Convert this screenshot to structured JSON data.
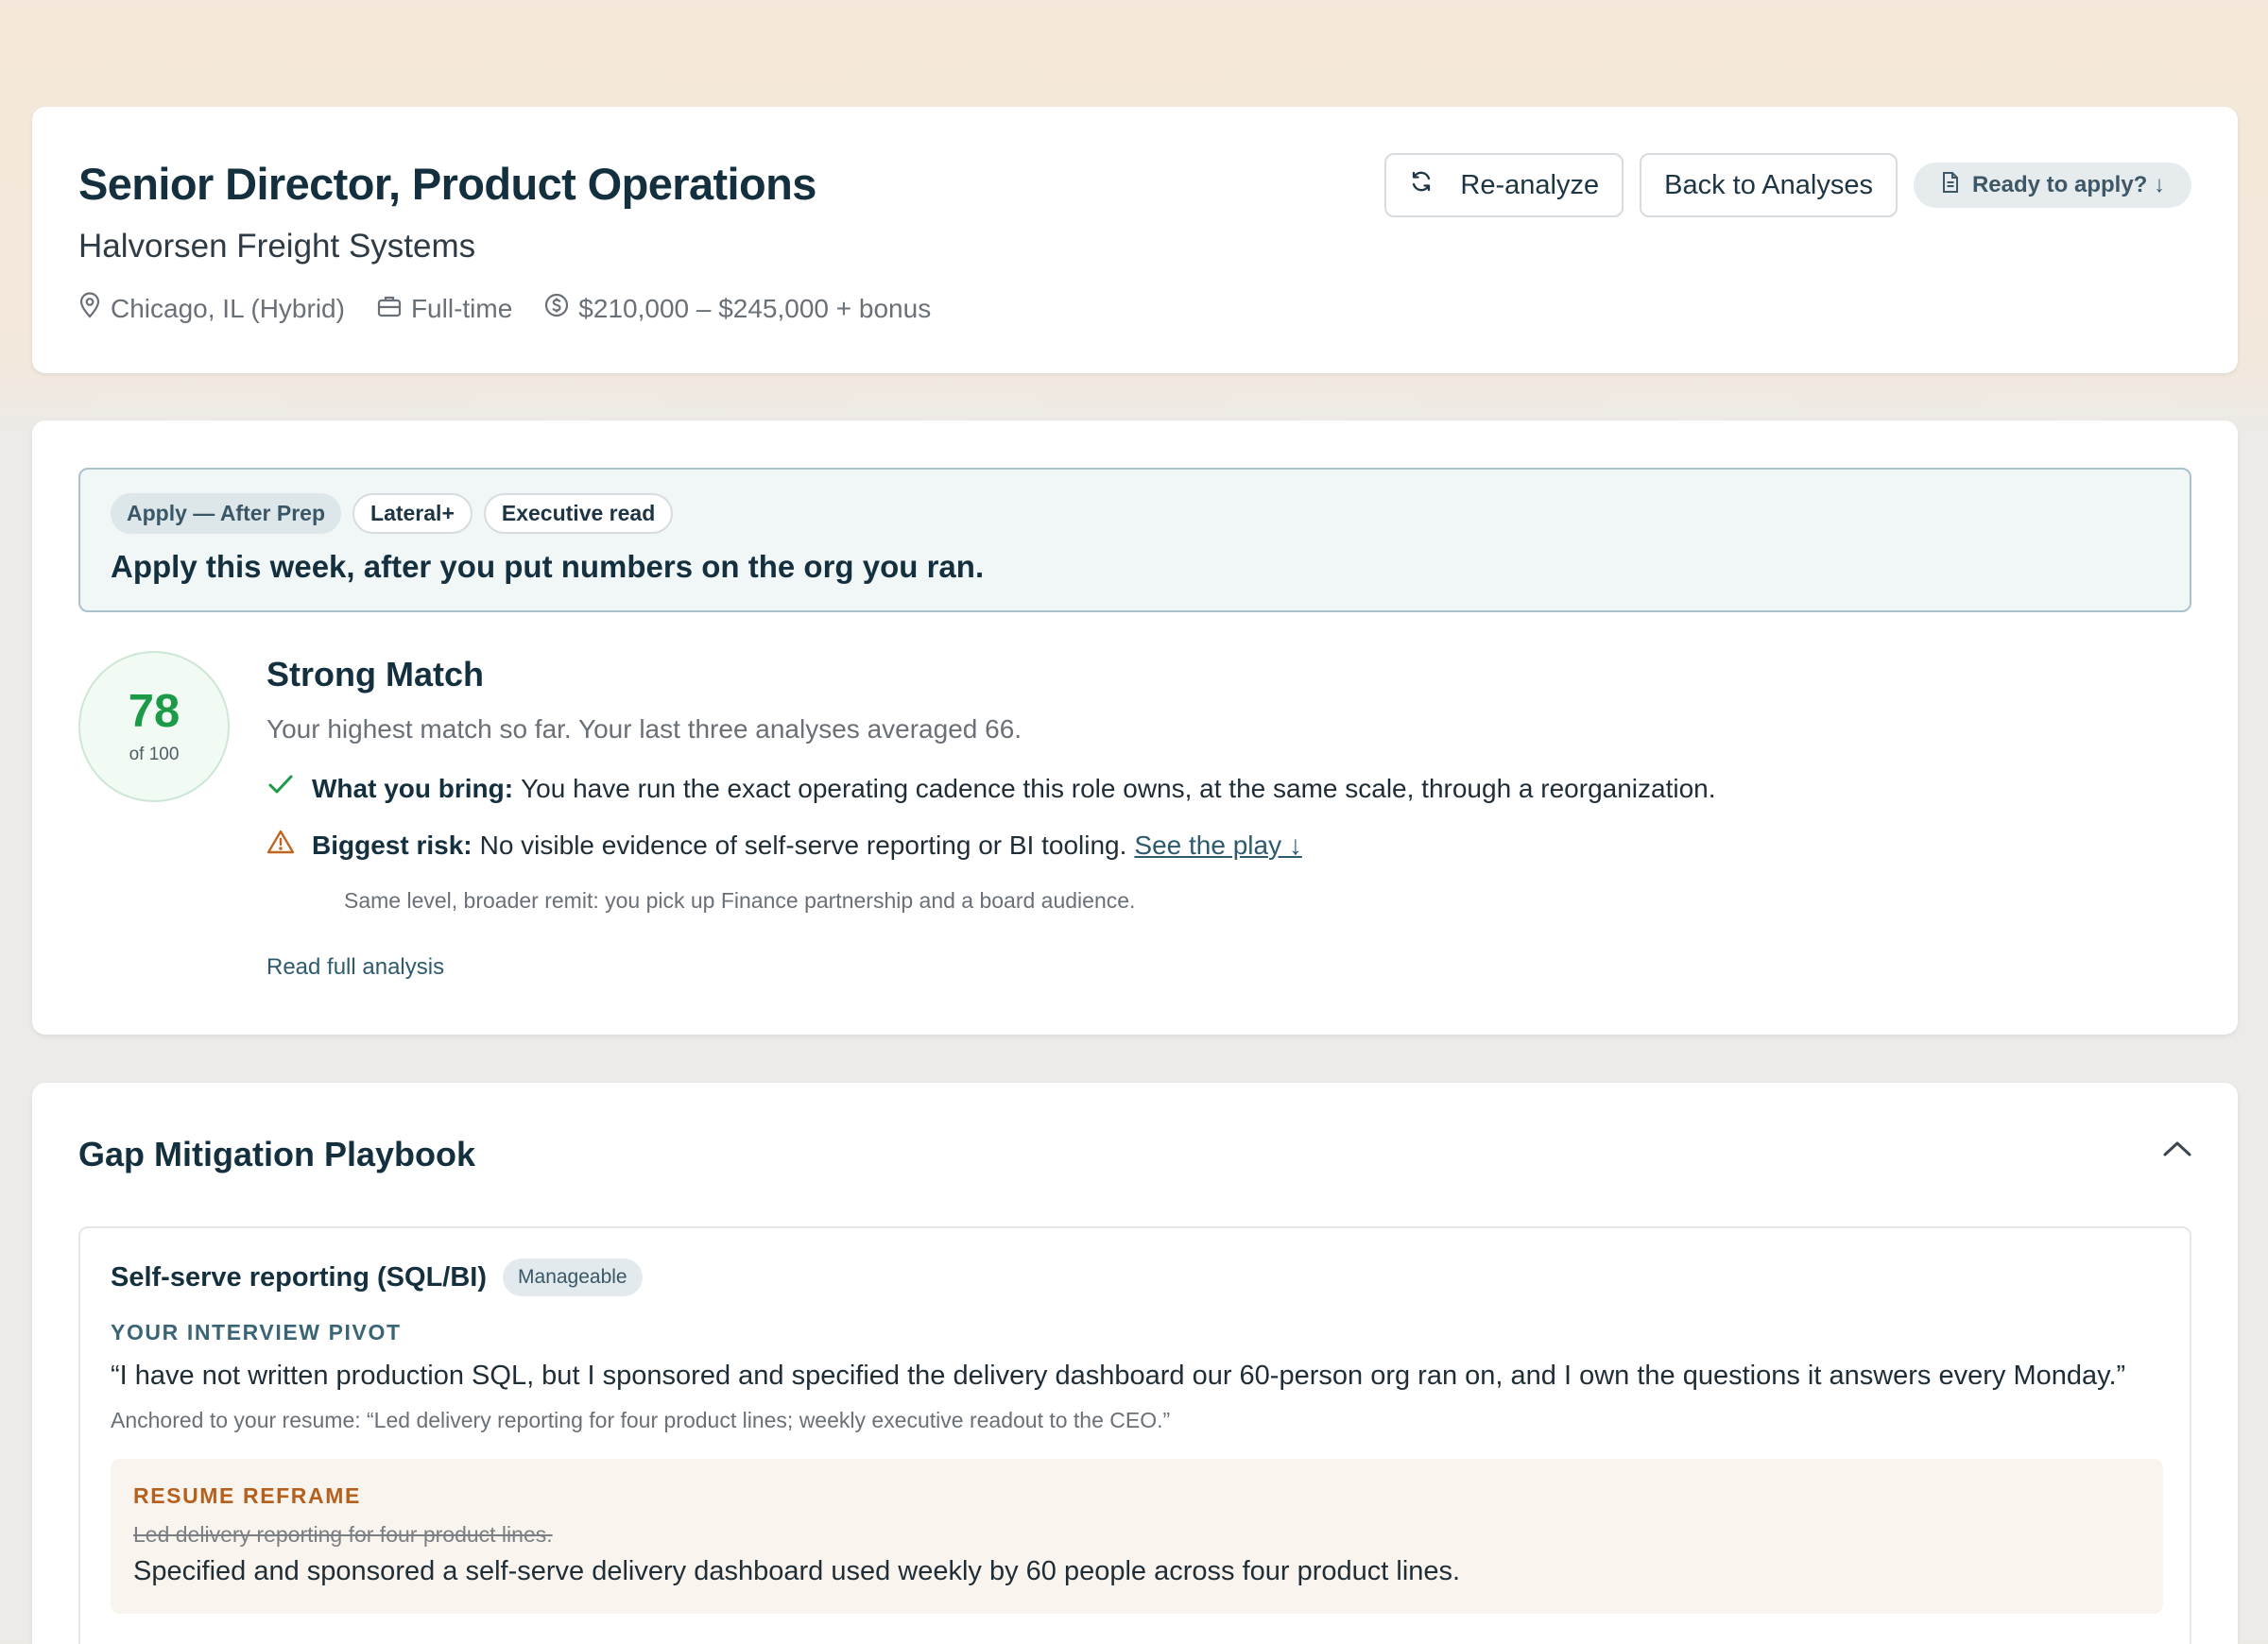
{
  "header": {
    "job_title": "Senior Director, Product Operations",
    "company": "Halvorsen Freight Systems",
    "location": "Chicago, IL (Hybrid)",
    "employment_type": "Full-time",
    "salary": "$210,000 – $245,000 + bonus",
    "icons": {
      "location": "map-pin-icon",
      "type": "briefcase-icon",
      "salary": "dollar-circle-icon"
    },
    "actions": {
      "reanalyze_label": "Re-analyze",
      "back_label": "Back to Analyses",
      "ready_label": "Ready to apply? ↓"
    }
  },
  "recommendation": {
    "chips": {
      "primary": "Apply — After Prep",
      "level": "Lateral+",
      "read": "Executive read"
    },
    "verdict": "Apply this week, after you put numbers on the org you ran.",
    "score": {
      "value": "78",
      "of": "of 100",
      "color": "#1d9a48"
    },
    "match_title": "Strong Match",
    "match_subtitle": "Your highest match so far. Your last three analyses averaged 66.",
    "bring": {
      "label": "What you bring:",
      "text": "You have run the exact operating cadence this role owns, at the same scale, through a reorganization."
    },
    "risk": {
      "label": "Biggest risk:",
      "text": "No visible evidence of self-serve reporting or BI tooling.",
      "link": "See the play ↓"
    },
    "level_note": "Same level, broader remit: you pick up Finance partnership and a board audience.",
    "read_full": "Read full analysis"
  },
  "playbook": {
    "title": "Gap Mitigation Playbook",
    "gap": {
      "name": "Self-serve reporting (SQL/BI)",
      "severity": "Manageable",
      "pivot_label": "YOUR INTERVIEW PIVOT",
      "pivot_quote": "“I have not written production SQL, but I sponsored and specified the delivery dashboard our 60-person org ran on, and I own the questions it answers every Monday.”",
      "anchor": "Anchored to your resume: “Led delivery reporting for four product lines; weekly executive readout to the CEO.”",
      "reframe_label": "RESUME REFRAME",
      "reframe_old": "Led delivery reporting for four product lines.",
      "reframe_new": "Specified and sponsored a self-serve delivery dashboard used weekly by 60 people across four product lines."
    }
  },
  "colors": {
    "accent": "#2d5a6e",
    "success": "#1d9a48",
    "warning": "#c0651f",
    "background_top": "#f5e8da"
  }
}
